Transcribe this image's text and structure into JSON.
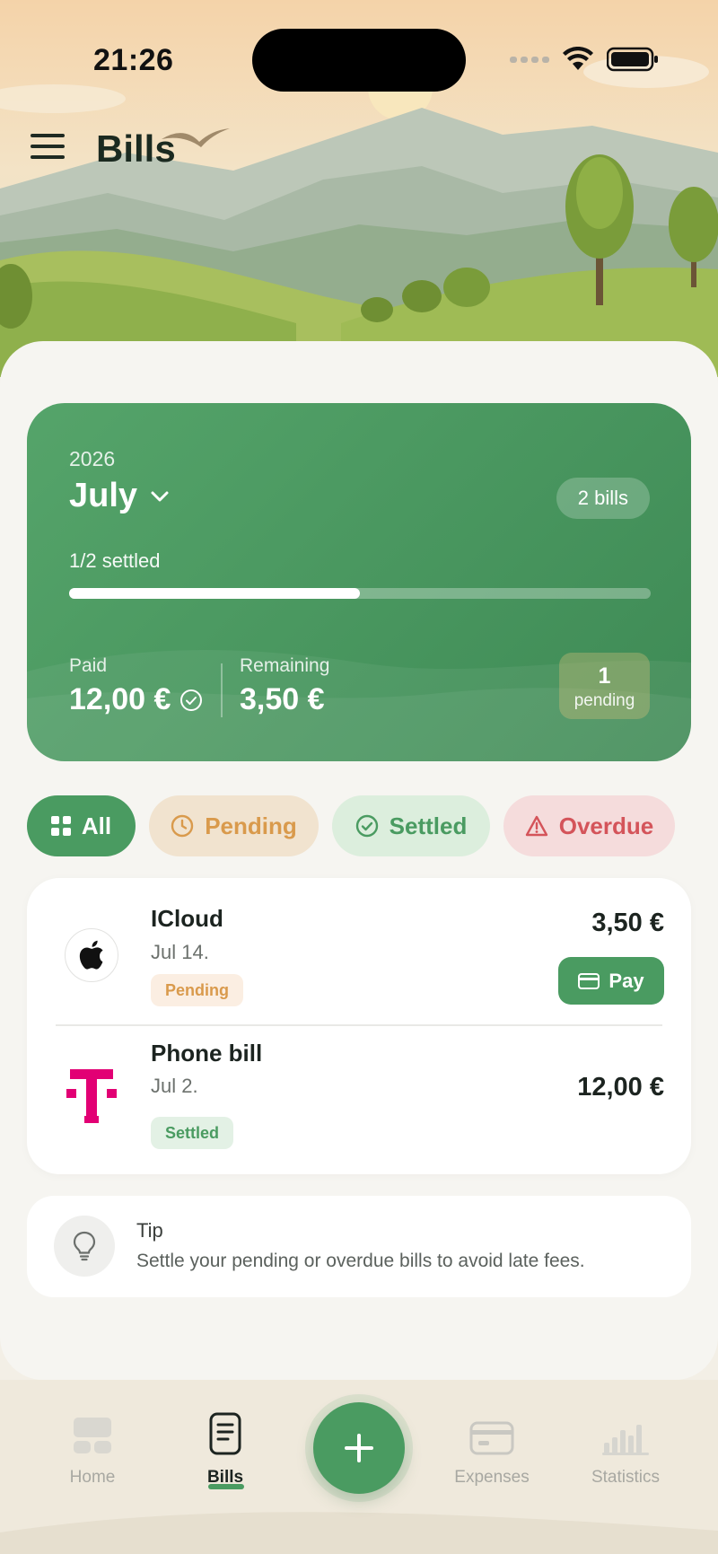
{
  "status_bar": {
    "time": "21:26"
  },
  "header": {
    "title": "Bills"
  },
  "summary": {
    "year": "2026",
    "month": "July",
    "bills_count": "2 bills",
    "settled_text": "1/2 settled",
    "progress_fraction": 0.5,
    "paid_label": "Paid",
    "paid_value": "12,00 €",
    "remaining_label": "Remaining",
    "remaining_value": "3,50 €",
    "pending_count": "1",
    "pending_label": "pending"
  },
  "filters": [
    {
      "label": "All",
      "icon": "grid-icon",
      "selected": true
    },
    {
      "label": "Pending",
      "icon": "clock-icon"
    },
    {
      "label": "Settled",
      "icon": "check-circle-icon"
    },
    {
      "label": "Overdue",
      "icon": "warning-icon"
    }
  ],
  "bills": [
    {
      "name": "ICloud",
      "date": "Jul 14.",
      "status": "Pending",
      "amount": "3,50 €",
      "action": "Pay",
      "logo": "apple-logo"
    },
    {
      "name": "Phone bill",
      "date": "Jul 2.",
      "status": "Settled",
      "amount": "12,00 €",
      "logo": "telekom-logo"
    }
  ],
  "tip": {
    "title": "Tip",
    "text": "Settle your pending or overdue bills to avoid late fees."
  },
  "bottom_nav": {
    "items": [
      {
        "label": "Home",
        "icon": "home-icon"
      },
      {
        "label": "Bills",
        "icon": "bills-icon",
        "active": true
      },
      {
        "label": "Expenses",
        "icon": "card-icon"
      },
      {
        "label": "Statistics",
        "icon": "chart-icon"
      }
    ],
    "fab_icon": "plus-icon"
  },
  "colors": {
    "accent": "#4a9b61",
    "pending": "#d99a4c",
    "overdue": "#d4545a",
    "telekom_magenta": "#e20074"
  }
}
